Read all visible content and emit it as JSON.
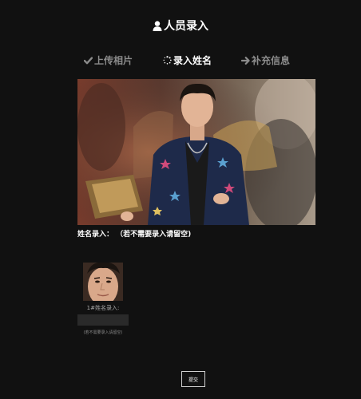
{
  "header": {
    "title": "人员录入",
    "icon": "user-icon"
  },
  "steps": [
    {
      "label": "上传相片",
      "icon": "check-icon",
      "state": "done"
    },
    {
      "label": "录入姓名",
      "icon": "spinner-icon",
      "state": "active"
    },
    {
      "label": "补充信息",
      "icon": "arrow-right-icon",
      "state": "pending"
    }
  ],
  "form": {
    "name_hint": "姓名录入： （若不需要录入请留空)",
    "faces": [
      {
        "label": "1#姓名录入:",
        "value": "",
        "hint": "(若不需要录入请留空)"
      }
    ],
    "submit_label": "提交"
  },
  "colors": {
    "background": "#111111",
    "active_step": "#ffffff",
    "inactive_step": "#8c8c8c"
  }
}
